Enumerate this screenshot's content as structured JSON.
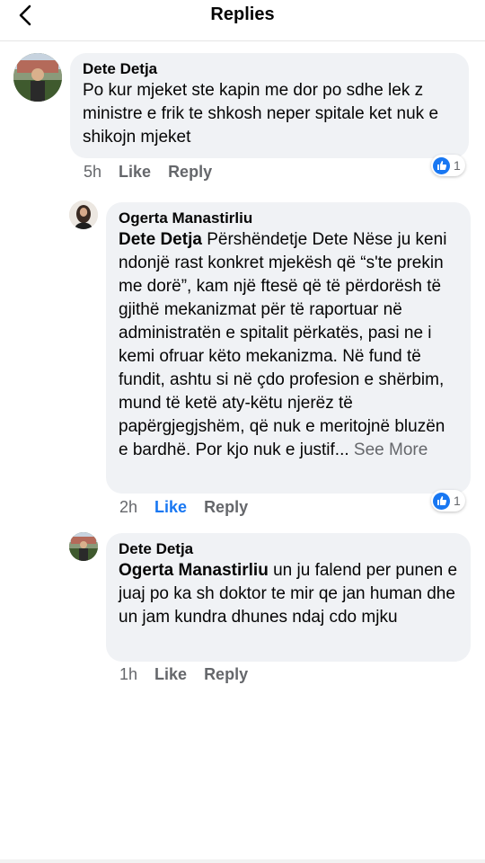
{
  "header": {
    "title": "Replies"
  },
  "comments": [
    {
      "author": "Dete Detja",
      "text": "Po kur mjeket ste kapin me dor po sdhe lek z ministre e frik te shkosh neper spitale ket nuk e shikojn mjeket",
      "time": "5h",
      "like_label": "Like",
      "reply_label": "Reply",
      "reactions": "1"
    },
    {
      "author": "Ogerta Manastirliu",
      "mention": "Dete Detja",
      "text": " Përshëndetje Dete Nëse ju keni ndonjë rast konkret mjekësh që “s'te prekin me dorë”, kam një ftesë që të përdorësh të gjithë mekanizmat për të raportuar në administratën e spitalit përkatës, pasi ne i kemi ofruar këto mekanizma. Në fund të fundit, ashtu si në çdo profesion e shërbim, mund të ketë aty-këtu njerëz të papërgjegjshëm, që nuk e meritojnë bluzën e bardhë. Por kjo nuk e justif...",
      "see_more": " See More",
      "time": "2h",
      "like_label": "Like",
      "reply_label": "Reply",
      "reactions": "1"
    },
    {
      "author": "Dete Detja",
      "mention": "Ogerta Manastirliu",
      "text": " un ju falend per punen e juaj po ka sh doktor te mir qe jan human dhe un jam kundra dhunes ndaj cdo mjku",
      "time": "1h",
      "like_label": "Like",
      "reply_label": "Reply"
    }
  ]
}
